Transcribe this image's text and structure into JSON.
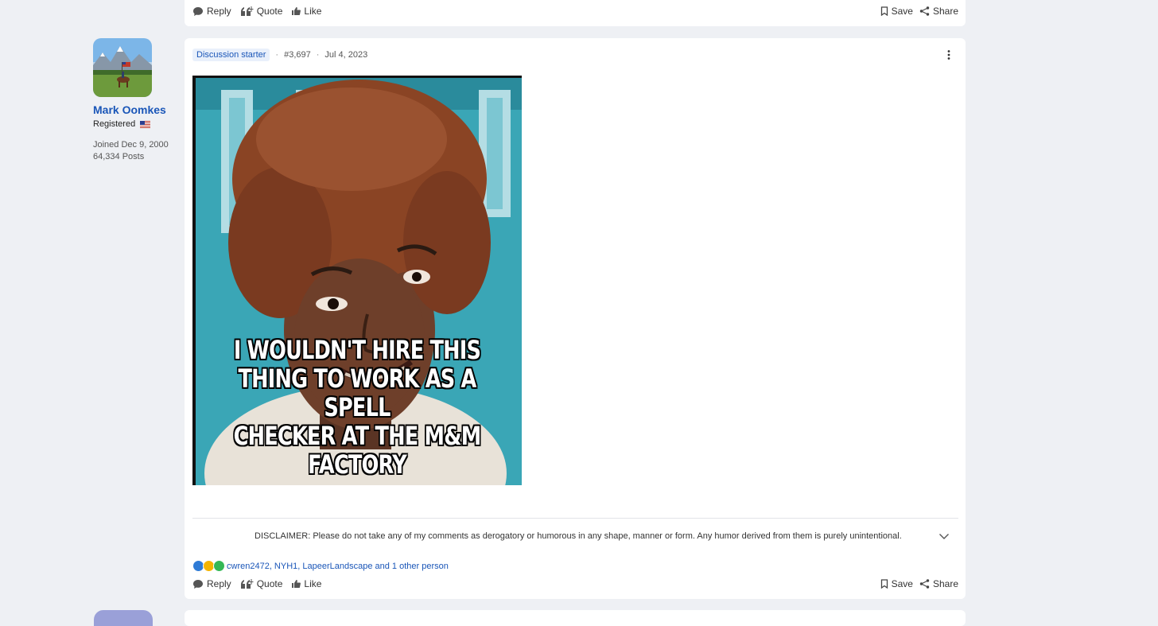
{
  "actions": {
    "reply": "Reply",
    "quote": "Quote",
    "like": "Like",
    "save": "Save",
    "share": "Share"
  },
  "author": {
    "name": "Mark Oomkes",
    "role": "Registered",
    "joined": "Joined Dec 9, 2000",
    "posts": "64,334 Posts"
  },
  "post": {
    "badge": "Discussion starter",
    "number": "#3,697",
    "date": "Jul 4, 2023",
    "meme_lines": [
      "I WOULDN'T HIRE THIS",
      "THING TO WORK AS A SPELL",
      "CHECKER AT THE M&M FACTORY"
    ],
    "signature": "DISCLAIMER: Please do not take any of my comments as derogatory or humorous in any shape, manner or form. Any humor derived from them is purely unintentional.",
    "reactors": "cwren2472, NYH1, LapeerLandscape and 1 other person"
  },
  "colors": {
    "page_bg": "#eef0f4",
    "link": "#1a56b8",
    "badge_bg": "#e9f0fb"
  }
}
